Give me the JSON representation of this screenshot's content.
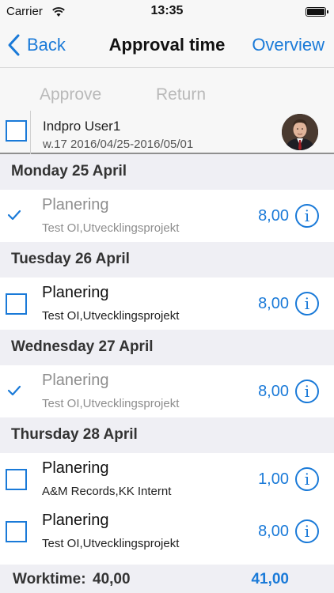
{
  "status_bar": {
    "carrier": "Carrier",
    "time": "13:35",
    "wifi_icon": "wifi-icon",
    "battery_icon": "battery-icon"
  },
  "nav": {
    "back_label": "Back",
    "title": "Approval time",
    "overview_label": "Overview"
  },
  "actions": {
    "approve_label": "Approve",
    "return_label": "Return"
  },
  "user": {
    "name": "Indpro User1",
    "week": "w.17  2016/04/25-2016/05/01",
    "avatar_icon": "user-photo"
  },
  "days": [
    {
      "label": "Monday 25 April",
      "entries": [
        {
          "title": "Planering",
          "project": "Test OI,Utvecklingsprojekt",
          "hours": "8,00",
          "approved": true
        }
      ]
    },
    {
      "label": "Tuesday 26 April",
      "entries": [
        {
          "title": "Planering",
          "project": "Test OI,Utvecklingsprojekt",
          "hours": "8,00",
          "approved": false
        }
      ]
    },
    {
      "label": "Wednesday 27 April",
      "entries": [
        {
          "title": "Planering",
          "project": "Test OI,Utvecklingsprojekt",
          "hours": "8,00",
          "approved": true
        }
      ]
    },
    {
      "label": "Thursday 28 April",
      "entries": [
        {
          "title": "Planering",
          "project": "A&M Records,KK Internt",
          "hours": "1,00",
          "approved": false
        },
        {
          "title": "Planering",
          "project": "Test OI,Utvecklingsprojekt",
          "hours": "8,00",
          "approved": false
        }
      ]
    }
  ],
  "info_glyph": "i",
  "footer": {
    "worktime_label": "Worktime:",
    "worktime_value": "40,00",
    "total_value": "41,00"
  },
  "colors": {
    "accent": "#1a7ad8",
    "header_bg": "#efeff4",
    "disabled": "#b9b9b9"
  }
}
